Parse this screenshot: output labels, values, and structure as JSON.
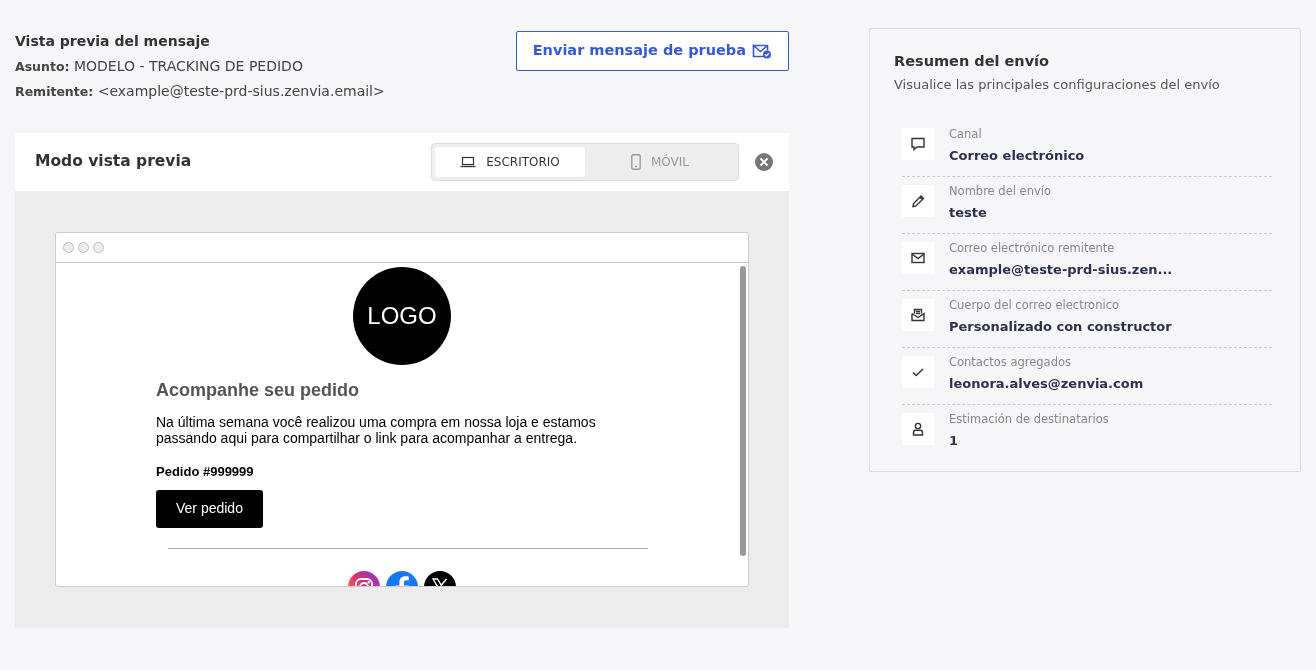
{
  "header": {
    "title": "Vista previa del mensaje",
    "subject_label": "Asunto:",
    "subject": "MODELO - TRACKING DE PEDIDO",
    "sender_label": "Remitente:",
    "sender": "<example@teste-prd-sius.zenvia.email>"
  },
  "test_button": {
    "label": "Enviar mensaje de prueba"
  },
  "preview": {
    "title": "Modo vista previa",
    "tabs": [
      {
        "label": "ESCRITORIO",
        "kind": "desktop",
        "selected": true
      },
      {
        "label": "MÓVIL",
        "kind": "mobile",
        "selected": false
      }
    ],
    "email": {
      "logo": "LOGO",
      "heading": "Acompanhe seu pedido",
      "body": "Na última semana você realizou uma compra em nossa loja e estamos passando aqui para compartilhar o link para acompanhar a entrega.",
      "order": "Pedido #999999",
      "button": "Ver pedido"
    }
  },
  "summary": {
    "title": "Resumen del envío",
    "subtitle": "Visualice las principales configuraciones del envío",
    "items": [
      {
        "kind": "chat",
        "label": "Canal",
        "value": "Correo electrónico"
      },
      {
        "kind": "pencil",
        "label": "Nombre del envío",
        "value": "teste"
      },
      {
        "kind": "mail",
        "label": "Correo electrónico remitente",
        "value": "example@teste-prd-sius.zen..."
      },
      {
        "kind": "mailbox",
        "label": "Cuerpo del correo electronico",
        "value": "Personalizado con constructor"
      },
      {
        "kind": "check",
        "label": "Contactos agregados",
        "value": "leonora.alves@zenvia.com"
      },
      {
        "kind": "person",
        "label": "Estimación de destinatarios",
        "value": "1"
      }
    ]
  }
}
